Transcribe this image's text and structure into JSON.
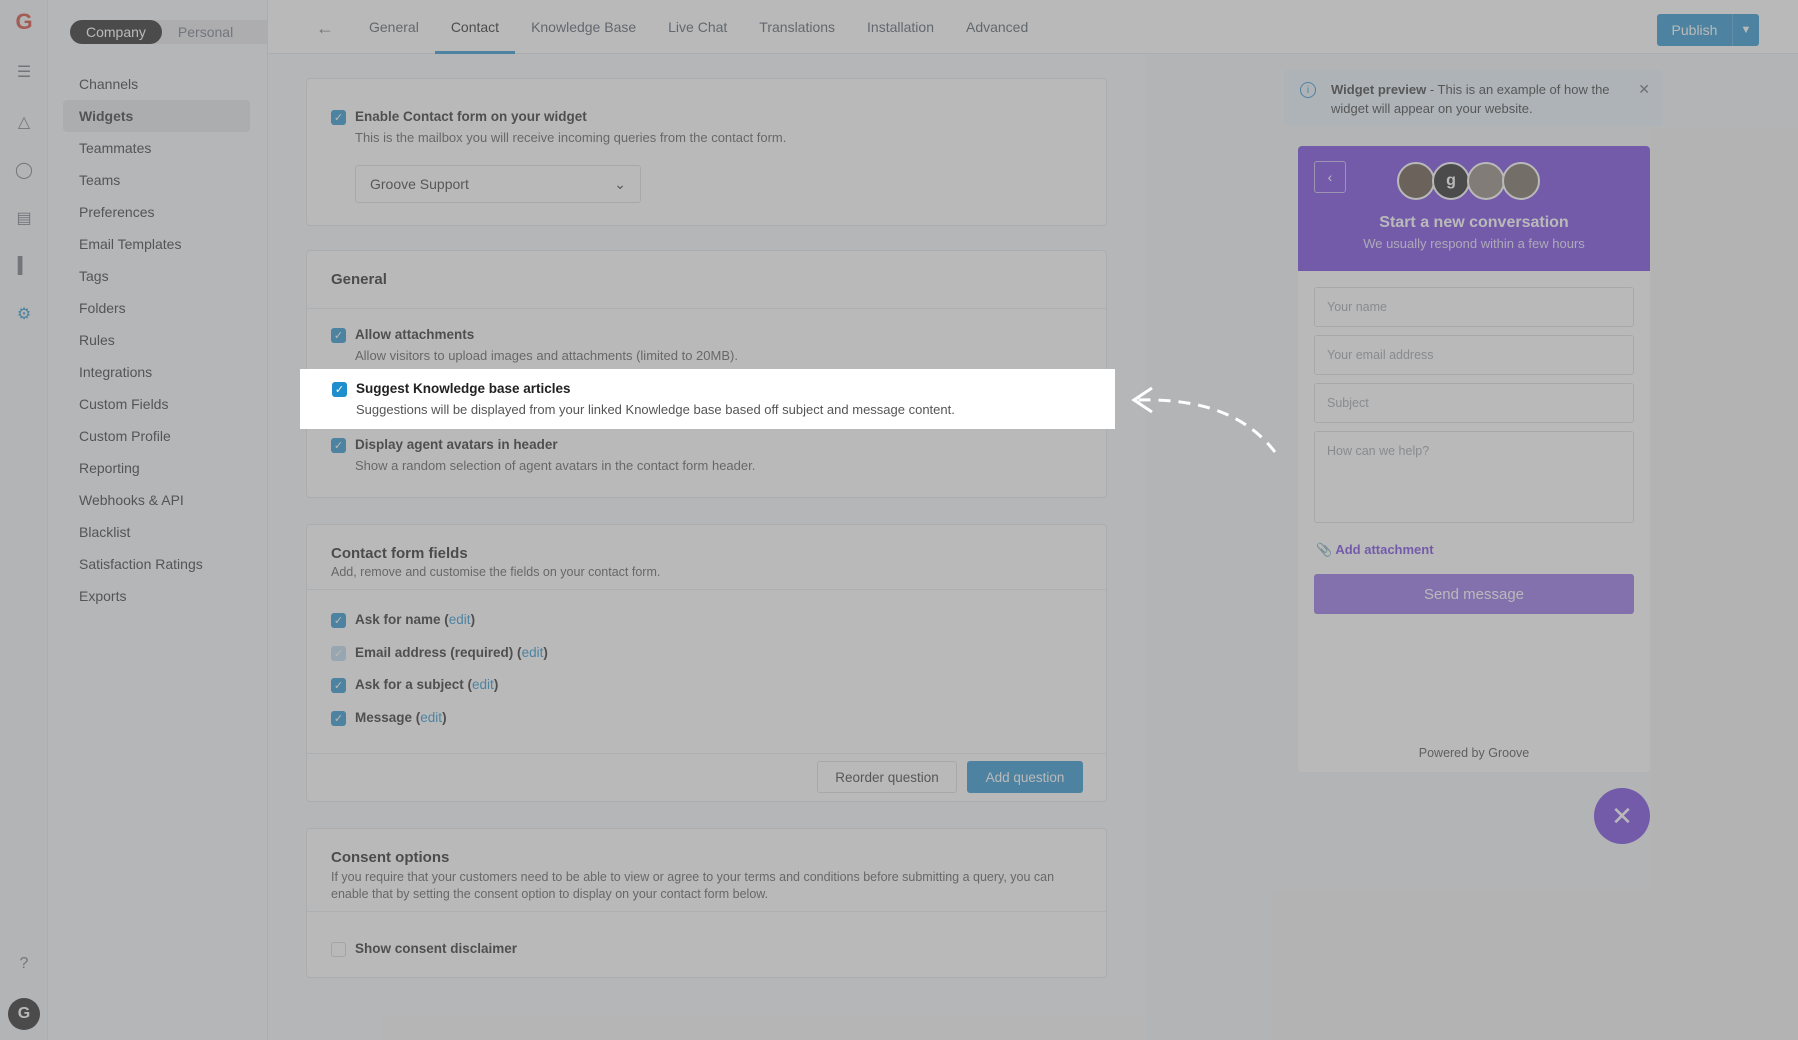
{
  "rail": {
    "logo": "G",
    "icons": [
      "menu-icon",
      "send-icon",
      "chat-icon",
      "book-icon",
      "chart-icon",
      "gear-icon",
      "help-icon"
    ],
    "avatar": "G"
  },
  "sidebar": {
    "toggle": {
      "company": "Company",
      "personal": "Personal"
    },
    "items": [
      {
        "label": "Channels"
      },
      {
        "label": "Widgets"
      },
      {
        "label": "Teammates"
      },
      {
        "label": "Teams"
      },
      {
        "label": "Preferences"
      },
      {
        "label": "Email Templates"
      },
      {
        "label": "Tags"
      },
      {
        "label": "Folders"
      },
      {
        "label": "Rules"
      },
      {
        "label": "Integrations"
      },
      {
        "label": "Custom Fields"
      },
      {
        "label": "Custom Profile"
      },
      {
        "label": "Reporting"
      },
      {
        "label": "Webhooks & API"
      },
      {
        "label": "Blacklist"
      },
      {
        "label": "Satisfaction Ratings"
      },
      {
        "label": "Exports"
      }
    ]
  },
  "tabs": [
    "General",
    "Contact",
    "Knowledge Base",
    "Live Chat",
    "Translations",
    "Installation",
    "Advanced"
  ],
  "active_tab": "Contact",
  "publish": {
    "label": "Publish"
  },
  "contact_form": {
    "enable_label": "Enable Contact form on your widget",
    "enable_desc": "This is the mailbox you will receive incoming queries from the contact form.",
    "mailbox": "Groove Support"
  },
  "general": {
    "title": "General",
    "attachments_label": "Allow attachments",
    "attachments_desc": "Allow visitors to upload images and attachments (limited to 20MB).",
    "suggest_label": "Suggest Knowledge base articles",
    "suggest_desc": "Suggestions will be displayed from your linked Knowledge base based off subject and message content.",
    "avatars_label": "Display agent avatars in header",
    "avatars_desc": "Show a random selection of agent avatars in the contact form header."
  },
  "fields": {
    "title": "Contact form fields",
    "desc": "Add, remove and customise the fields on your contact form.",
    "edit": "edit",
    "items": [
      {
        "label": "Ask for name ("
      },
      {
        "label": "Email address (required) ("
      },
      {
        "label": "Ask for a subject ("
      },
      {
        "label": "Message ("
      }
    ],
    "close_paren": ")",
    "reorder": "Reorder question",
    "add": "Add question"
  },
  "consent": {
    "title": "Consent options",
    "desc": "If you require that your customers need to be able to view or agree to your terms and conditions before submitting a query, you can enable that by setting the consent option to display on your contact form below.",
    "show_label": "Show consent disclaimer"
  },
  "preview": {
    "note_title": "Widget preview",
    "note_text": " - This is an example of how the widget will appear on your website.",
    "title": "Start a new conversation",
    "subtitle": "We usually respond within a few hours",
    "name_ph": "Your name",
    "email_ph": "Your email address",
    "subject_ph": "Subject",
    "message_ph": "How can we help?",
    "attach": "Add attachment",
    "send": "Send message",
    "powered": "Powered by Groove",
    "accent": "#6d3ce0"
  }
}
